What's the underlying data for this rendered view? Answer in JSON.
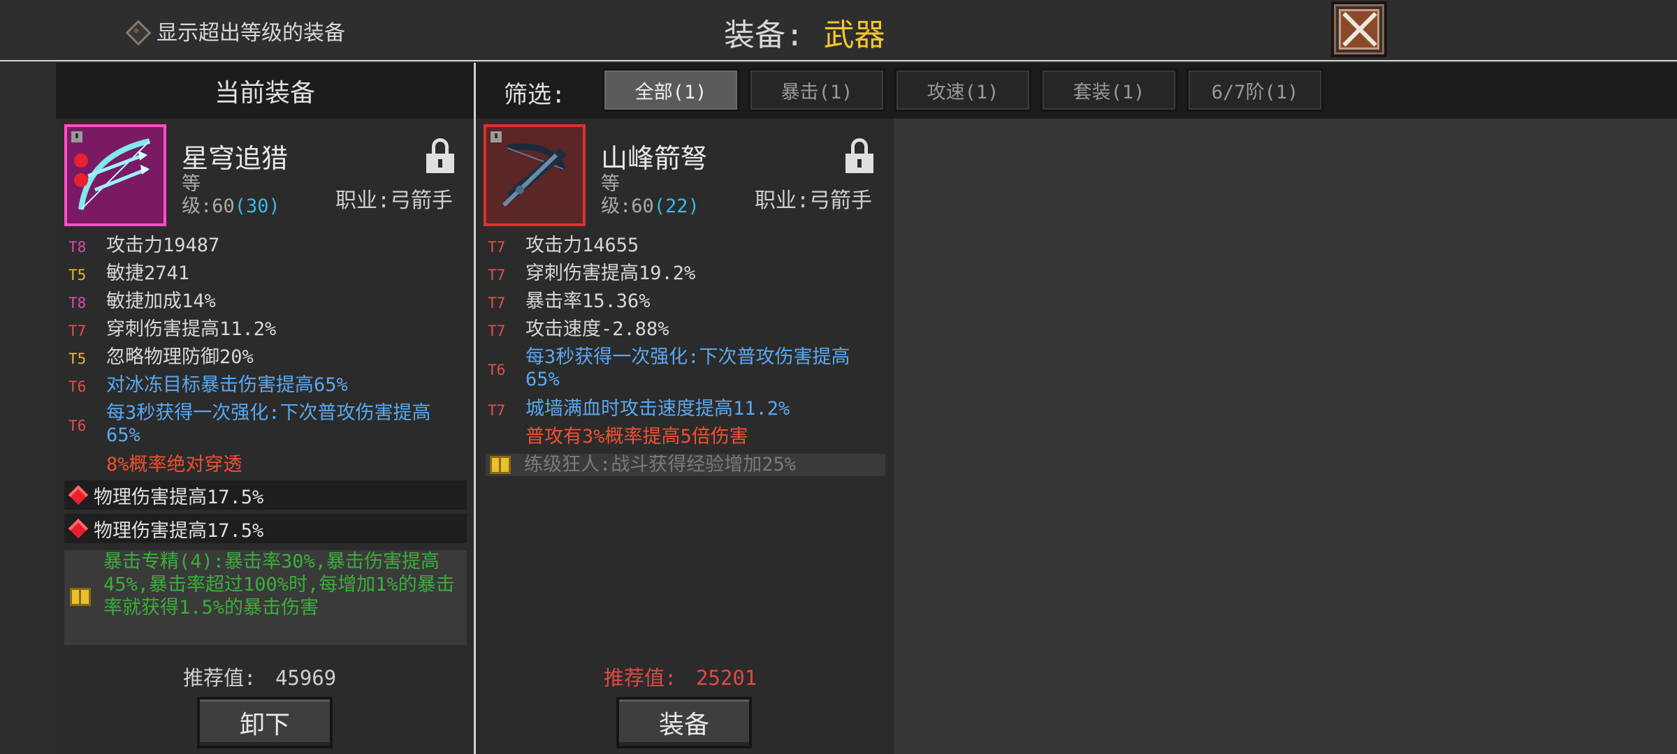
{
  "top": {
    "show_over_level_label": "显示超出等级的装备",
    "title_label": "装备:",
    "title_value": "武器"
  },
  "left": {
    "header": "当前装备",
    "item": {
      "name": "星穹追猎",
      "level_prefix": "等级:60",
      "level_extra": "(30)",
      "job": "职业:弓箭手"
    },
    "stats": [
      {
        "tier": "T8",
        "text": "攻击力19487"
      },
      {
        "tier": "T5",
        "text": "敏捷2741"
      },
      {
        "tier": "T8",
        "text": "敏捷加成14%"
      },
      {
        "tier": "T7",
        "text": "穿刺伤害提高11.2%"
      },
      {
        "tier": "T5",
        "text": "忽略物理防御20%"
      },
      {
        "tier": "T6",
        "text": "对冰冻目标暴击伤害提高65%"
      },
      {
        "tier": "T6",
        "text": "每3秒获得一次强化:下次普攻伤害提高65%"
      },
      {
        "tier": "",
        "text": "8%概率绝对穿透"
      }
    ],
    "gems": [
      "物理伤害提高17.5%",
      "物理伤害提高17.5%"
    ],
    "set_text": "暴击专精(4):暴击率30%,暴击伤害提高45%,暴击率超过100%时,每增加1%的暴击率就获得1.5%的暴击伤害",
    "recommend_label": "推荐值:",
    "recommend_value": "45969",
    "button": "卸下"
  },
  "filter": {
    "label": "筛选:",
    "tabs": [
      "全部(1)",
      "暴击(1)",
      "攻速(1)",
      "套装(1)",
      "6/7阶(1)"
    ]
  },
  "mid": {
    "item": {
      "name": "山峰箭弩",
      "level_prefix": "等级:60",
      "level_extra": "(22)",
      "job": "职业:弓箭手"
    },
    "stats": [
      {
        "tier": "T7",
        "text": "攻击力14655"
      },
      {
        "tier": "T7",
        "text": "穿刺伤害提高19.2%"
      },
      {
        "tier": "T7",
        "text": "暴击率15.36%"
      },
      {
        "tier": "T7",
        "text": "攻击速度-2.88%"
      },
      {
        "tier": "T6",
        "text": "每3秒获得一次强化:下次普攻伤害提高65%"
      },
      {
        "tier": "T7",
        "text": "城墙满血时攻击速度提高11.2%"
      },
      {
        "tier": "",
        "text": "普攻有3%概率提高5倍伤害"
      }
    ],
    "passive": "练级狂人:战斗获得经验增加25%",
    "recommend_label": "推荐值:",
    "recommend_value": "25201",
    "button": "装备"
  },
  "colors": {
    "accent_gold": "#f2c531",
    "tier_t8": "#e048b0",
    "tier_t7": "#e05050",
    "tier_t5": "#e8b830",
    "affix_blue": "#5aa8f0",
    "affix_red": "#f05030",
    "set_green": "#3aae3a"
  }
}
